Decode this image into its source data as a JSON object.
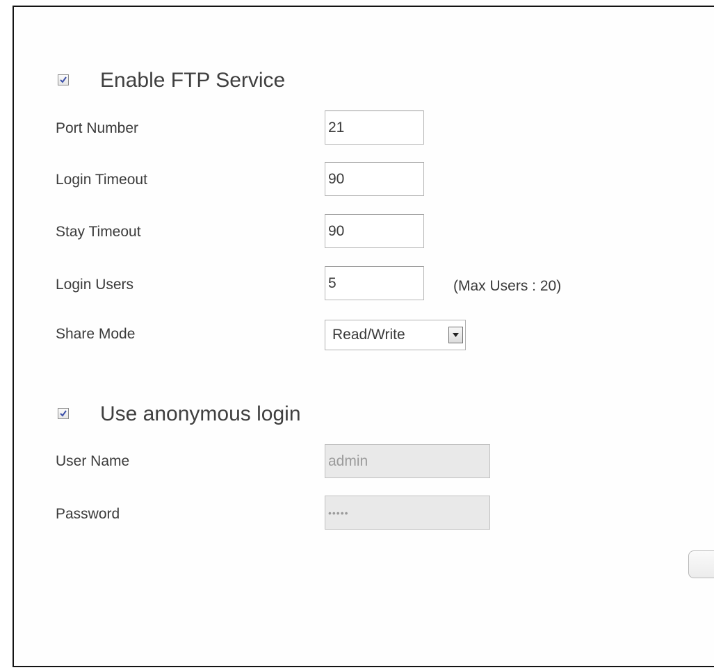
{
  "ftp": {
    "enable_label": "Enable FTP Service",
    "enabled": true,
    "fields": {
      "port": {
        "label": "Port Number",
        "value": "21"
      },
      "login_timeout": {
        "label": "Login Timeout",
        "value": "90"
      },
      "stay_timeout": {
        "label": "Stay Timeout",
        "value": "90"
      },
      "login_users": {
        "label": "Login Users",
        "value": "5",
        "hint": "(Max Users : 20)"
      },
      "share_mode": {
        "label": "Share Mode",
        "value": "Read/Write"
      }
    }
  },
  "anonymous": {
    "label": "Use anonymous login",
    "enabled": true,
    "user_name": {
      "label": "User Name",
      "value": "admin"
    },
    "password": {
      "label": "Password",
      "value": "•••••"
    }
  },
  "icons": {
    "checkbox_check": "checkmark-icon",
    "select_arrow": "chevron-down-icon"
  },
  "colors": {
    "check": "#3b4fa8",
    "disabled_field": "#e9e9e9",
    "border": "#141414"
  }
}
